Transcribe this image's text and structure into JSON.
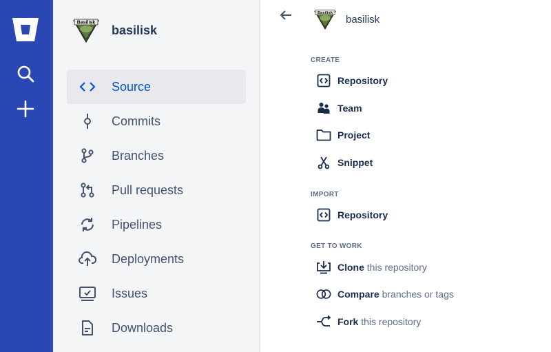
{
  "colors": {
    "rail_bg": "#2a47b3",
    "sidebar_bg": "#f4f5f7",
    "active_bg": "#e7e9ed",
    "accent": "#0052cc",
    "text": "#172b4d",
    "muted": "#5e6c84"
  },
  "rail": {
    "logo_icon": "bitbucket-logo",
    "search_icon": "search-icon",
    "create_icon": "plus-icon"
  },
  "repo": {
    "avatar_text": "Basilisk",
    "name": "basilisk"
  },
  "sidebar": {
    "items": [
      {
        "label": "Source",
        "icon": "code-icon",
        "active": true
      },
      {
        "label": "Commits",
        "icon": "commit-icon"
      },
      {
        "label": "Branches",
        "icon": "branch-icon"
      },
      {
        "label": "Pull requests",
        "icon": "pull-request-icon"
      },
      {
        "label": "Pipelines",
        "icon": "pipelines-icon"
      },
      {
        "label": "Deployments",
        "icon": "cloud-upload-icon"
      },
      {
        "label": "Issues",
        "icon": "issues-icon"
      },
      {
        "label": "Downloads",
        "icon": "document-icon"
      }
    ]
  },
  "panel": {
    "back_icon": "arrow-left-icon",
    "repo_name": "basilisk",
    "sections": {
      "create": {
        "title": "CREATE",
        "items": [
          {
            "label": "Repository",
            "icon": "repository-icon"
          },
          {
            "label": "Team",
            "icon": "team-icon"
          },
          {
            "label": "Project",
            "icon": "folder-icon"
          },
          {
            "label": "Snippet",
            "icon": "snippet-icon"
          }
        ]
      },
      "import": {
        "title": "IMPORT",
        "items": [
          {
            "label": "Repository",
            "icon": "repository-icon"
          }
        ]
      },
      "work": {
        "title": "GET TO WORK",
        "items": [
          {
            "bold": "Clone",
            "rest": "this repository",
            "icon": "clone-icon"
          },
          {
            "bold": "Compare",
            "rest": "branches or tags",
            "icon": "compare-icon"
          },
          {
            "bold": "Fork",
            "rest": "this repository",
            "icon": "fork-icon"
          }
        ]
      }
    }
  }
}
